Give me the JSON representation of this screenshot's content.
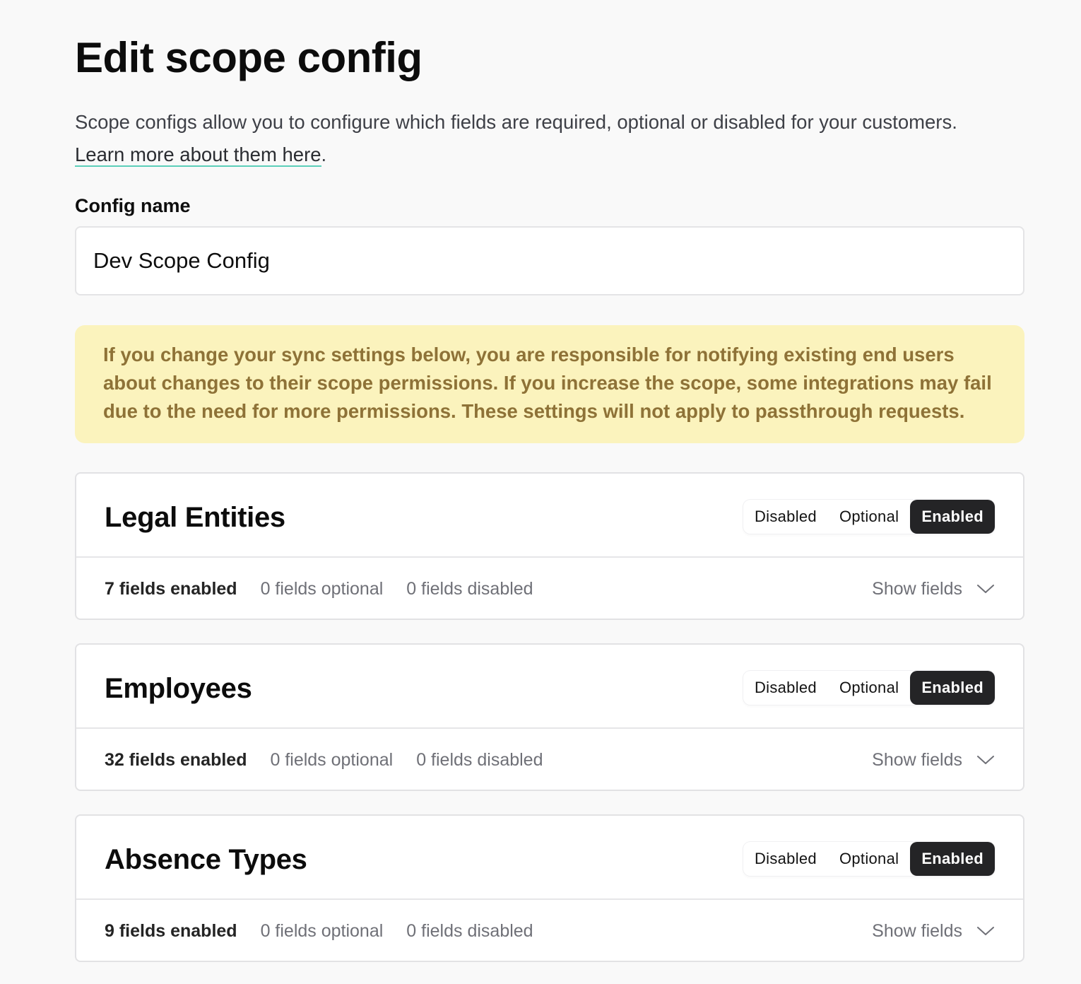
{
  "page": {
    "title": "Edit scope config",
    "description": "Scope configs allow you to configure which fields are required, optional or disabled for your customers.",
    "learn_more_link": "Learn more about them here",
    "learn_more_suffix": "."
  },
  "form": {
    "config_name_label": "Config name",
    "config_name_value": "Dev Scope Config"
  },
  "warning": {
    "text": "If you change your sync settings below, you are responsible for notifying existing end users about changes to their scope permissions. If you increase the scope, some integrations may fail due to the need for more permissions. These settings will not apply to passthrough requests."
  },
  "toggle_labels": {
    "disabled": "Disabled",
    "optional": "Optional",
    "enabled": "Enabled"
  },
  "models": [
    {
      "title": "Legal Entities",
      "selected": "Enabled",
      "fields_enabled": "7 fields enabled",
      "fields_optional": "0 fields optional",
      "fields_disabled": "0 fields disabled",
      "show_fields_label": "Show fields"
    },
    {
      "title": "Employees",
      "selected": "Enabled",
      "fields_enabled": "32 fields enabled",
      "fields_optional": "0 fields optional",
      "fields_disabled": "0 fields disabled",
      "show_fields_label": "Show fields"
    },
    {
      "title": "Absence Types",
      "selected": "Enabled",
      "fields_enabled": "9 fields enabled",
      "fields_optional": "0 fields optional",
      "fields_disabled": "0 fields disabled",
      "show_fields_label": "Show fields"
    }
  ],
  "colors": {
    "background": "#f9f9f9",
    "warning_bg": "#fbf3bd",
    "warning_text": "#8e7237",
    "active_toggle": "#242426",
    "link_underline": "#5ccfb9"
  },
  "icons": {
    "show_fields": "chevron-down-icon"
  }
}
